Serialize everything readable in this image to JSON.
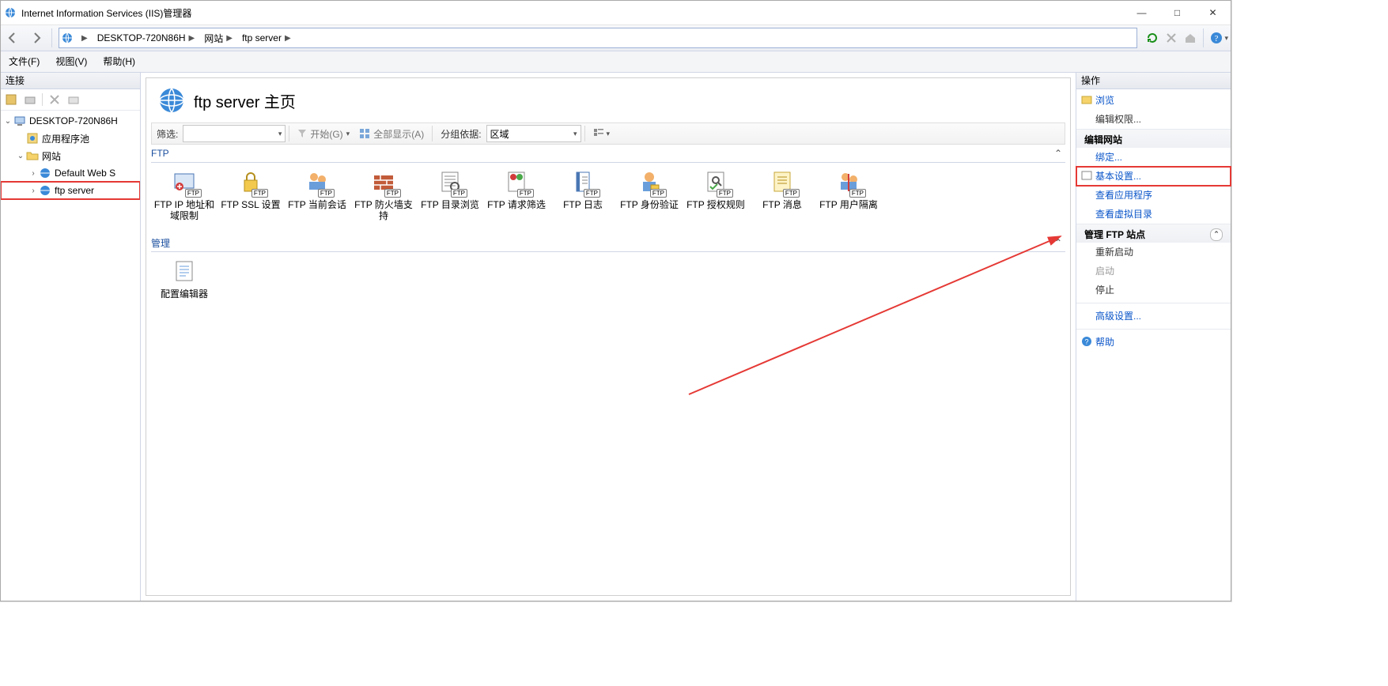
{
  "title": "Internet Information Services (IIS)管理器",
  "sysbuttons": {
    "min": "—",
    "max": "□",
    "close": "✕"
  },
  "breadcrumbs": [
    "DESKTOP-720N86H",
    "网站",
    "ftp server"
  ],
  "menus": [
    "文件(F)",
    "视图(V)",
    "帮助(H)"
  ],
  "left": {
    "header": "连接",
    "tree": {
      "root": "DESKTOP-720N86H",
      "appPools": "应用程序池",
      "sites": "网站",
      "defaultSite": "Default Web S",
      "ftpServer": "ftp server"
    }
  },
  "center": {
    "pageTitle": "ftp server 主页",
    "filter": {
      "label": "筛选:",
      "startBtn": "开始(G)",
      "showAll": "全部显示(A)",
      "groupByLabel": "分组依据:",
      "groupByValue": "区域"
    },
    "groups": [
      {
        "name": "FTP",
        "items": [
          {
            "label": "FTP IP 地址和域限制",
            "icon": "ip"
          },
          {
            "label": "FTP SSL 设置",
            "icon": "ssl"
          },
          {
            "label": "FTP 当前会话",
            "icon": "sessions"
          },
          {
            "label": "FTP 防火墙支持",
            "icon": "firewall"
          },
          {
            "label": "FTP 目录浏览",
            "icon": "browse"
          },
          {
            "label": "FTP 请求筛选",
            "icon": "filter"
          },
          {
            "label": "FTP 日志",
            "icon": "log"
          },
          {
            "label": "FTP 身份验证",
            "icon": "auth"
          },
          {
            "label": "FTP 授权规则",
            "icon": "authz"
          },
          {
            "label": "FTP 消息",
            "icon": "msg"
          },
          {
            "label": "FTP 用户隔离",
            "icon": "iso"
          }
        ]
      },
      {
        "name": "管理",
        "items": [
          {
            "label": "配置编辑器",
            "icon": "cfg"
          }
        ]
      }
    ]
  },
  "right": {
    "header": "操作",
    "browse": "浏览",
    "editPerm": "编辑权限...",
    "editSite": "编辑网站",
    "binding": "绑定...",
    "basicSettings": "基本设置...",
    "viewApps": "查看应用程序",
    "viewVdir": "查看虚拟目录",
    "manageFtp": "管理 FTP 站点",
    "restart": "重新启动",
    "start": "启动",
    "stop": "停止",
    "adv": "高级设置...",
    "help": "帮助"
  }
}
